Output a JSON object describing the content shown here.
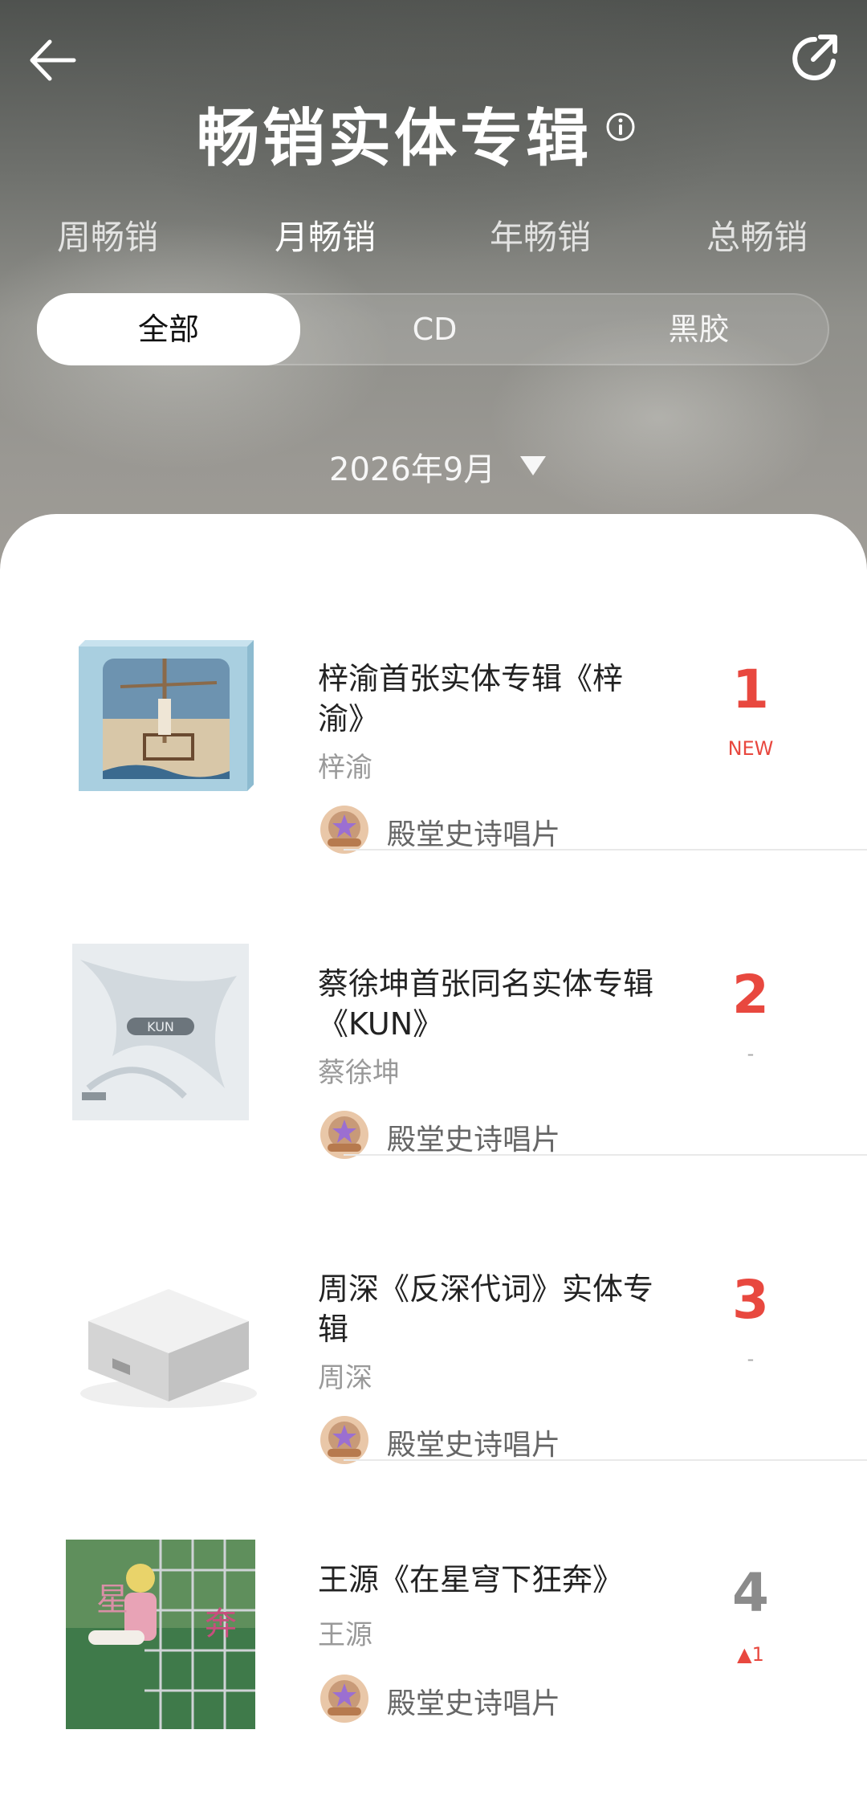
{
  "header": {
    "title": "畅销实体专辑"
  },
  "period_tabs": [
    {
      "label": "周畅销",
      "active": false
    },
    {
      "label": "月畅销",
      "active": true
    },
    {
      "label": "年畅销",
      "active": false
    },
    {
      "label": "总畅销",
      "active": false
    }
  ],
  "format_tabs": [
    {
      "label": "全部",
      "active": true
    },
    {
      "label": "CD",
      "active": false
    },
    {
      "label": "黑胶",
      "active": false
    }
  ],
  "date_picker": {
    "value": "2026年9月"
  },
  "albums": [
    {
      "rank": "1",
      "title": "梓渝首张实体专辑《梓渝》",
      "artist": "梓渝",
      "label": "殿堂史诗唱片",
      "trend": "NEW"
    },
    {
      "rank": "2",
      "title": "蔡徐坤首张同名实体专辑《KUN》",
      "artist": "蔡徐坤",
      "label": "殿堂史诗唱片",
      "trend": "-"
    },
    {
      "rank": "3",
      "title": "周深《反深代词》实体专辑",
      "artist": "周深",
      "label": "殿堂史诗唱片",
      "trend": "-"
    },
    {
      "rank": "4",
      "title": "王源《在星穹下狂奔》",
      "artist": "王源",
      "label": "殿堂史诗唱片",
      "trend": "▲1"
    }
  ],
  "colors": {
    "accent": "#e8483f",
    "rank_grey": "#8b8b8b"
  }
}
